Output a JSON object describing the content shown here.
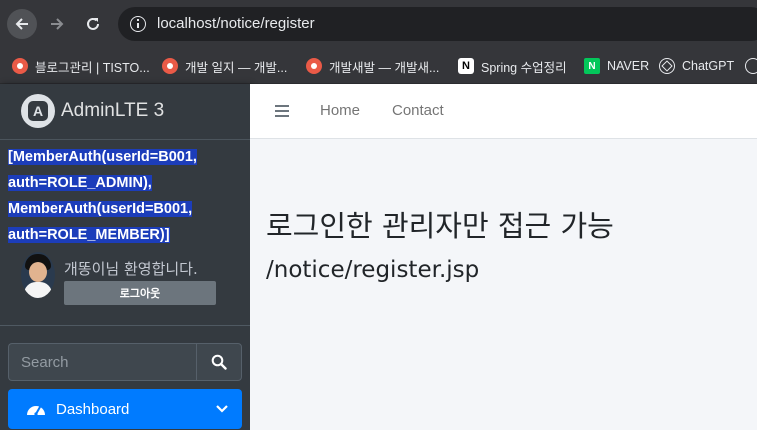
{
  "browser": {
    "url": "localhost/notice/register",
    "bookmarks": [
      {
        "label": "블로그관리 | TISTO...",
        "icon": "tistory-icon"
      },
      {
        "label": "개발 일지 — 개발...",
        "icon": "tistory-icon"
      },
      {
        "label": "개발새발 — 개발새...",
        "icon": "tistory-icon"
      },
      {
        "label": "Spring 수업정리",
        "icon": "notion-icon"
      },
      {
        "label": "NAVER",
        "icon": "naver-icon"
      },
      {
        "label": "ChatGPT",
        "icon": "chatgpt-icon"
      }
    ]
  },
  "sidebar": {
    "brand": "AdminLTE 3",
    "auth_lines": [
      "[MemberAuth(userId=B001,",
      "auth=ROLE_ADMIN),",
      "MemberAuth(userId=B001,",
      "auth=ROLE_MEMBER)]"
    ],
    "welcome": "개똥이님 환영합니다.",
    "logout": "로그아웃",
    "search_placeholder": "Search",
    "menu": {
      "dashboard": "Dashboard"
    }
  },
  "header": {
    "nav": {
      "home": "Home",
      "contact": "Contact"
    }
  },
  "content": {
    "title": "로그인한 관리자만 접근 가능",
    "subtitle": "/notice/register.jsp"
  },
  "colors": {
    "accent": "#007bff",
    "sidebar_bg": "#343a40",
    "selection": "#1c3dba"
  }
}
